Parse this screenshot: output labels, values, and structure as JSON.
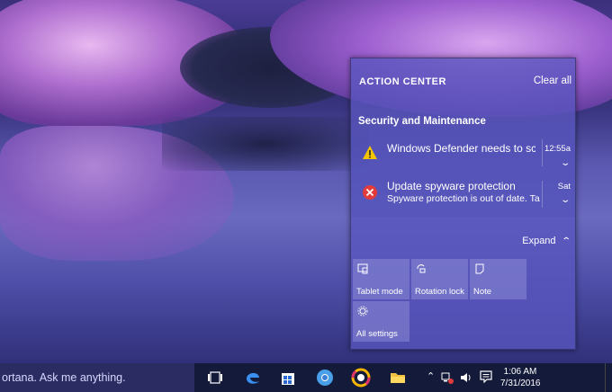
{
  "action_center": {
    "title": "ACTION CENTER",
    "clear_all": "Clear all",
    "group": "Security and Maintenance",
    "notifications": [
      {
        "title": "Windows Defender needs to scan",
        "time": "12:55a"
      },
      {
        "title": "Update spyware protection",
        "body": "Spyware protection is out of date. Tap",
        "time": "Sat"
      }
    ],
    "expand": "Expand",
    "tiles": [
      {
        "label": "Tablet mode"
      },
      {
        "label": "Rotation lock"
      },
      {
        "label": "Note"
      },
      {
        "label": "All settings"
      }
    ]
  },
  "taskbar": {
    "cortana_text": "ortana. Ask me anything.",
    "clock_time": "1:06 AM",
    "clock_date": "7/31/2016"
  }
}
